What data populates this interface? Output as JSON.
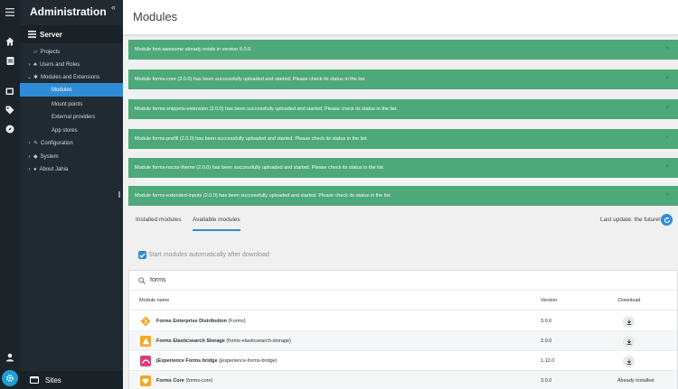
{
  "rail": {
    "icons": [
      "menu-icon",
      "home-icon",
      "clipboard-icon",
      "gallery-icon",
      "tag-icon",
      "compass-icon",
      "user-icon",
      "gear-icon"
    ]
  },
  "sidebar": {
    "title": "Administration",
    "collapse": "«",
    "server_label": "Server",
    "items": [
      {
        "label": "Projects",
        "prefix": "▱"
      },
      {
        "label": "Users and Roles",
        "arrow": "›",
        "prefix": "♣"
      },
      {
        "label": "Modules and Extensions",
        "arrow": "⌄",
        "prefix": "✱"
      },
      {
        "label": "Modules",
        "active": true
      },
      {
        "label": "Mount points"
      },
      {
        "label": "External providers"
      },
      {
        "label": "App stores"
      },
      {
        "label": "Configuration",
        "arrow": "›",
        "prefix": "✎"
      },
      {
        "label": "System",
        "arrow": "›",
        "prefix": "◆"
      },
      {
        "label": "About Jahia",
        "arrow": "›",
        "prefix": "●"
      }
    ],
    "sites_label": "Sites"
  },
  "header": {
    "title": "Modules"
  },
  "notifications": [
    "Module font-awesome already exists in version 6.0.0.",
    "Module forms-core (3.0.0) has been successfully uploaded and started. Please check its status in the list.",
    "Module forms-snippets-extension (3.0.0) has been successfully uploaded and started. Please check its status in the list.",
    "Module forms-prefill (2.0.0) has been successfully uploaded and started. Please check its status in the list.",
    "Module forms-nocss-theme (2.0.0) has been successfully uploaded and started. Please check its status in the list.",
    "Module forms-extended-inputs (2.0.0) has been successfully uploaded and started. Please check its status in the list."
  ],
  "notification_close": "×",
  "tabs": [
    {
      "label": "Installed modules",
      "active": false
    },
    {
      "label": "Available modules",
      "active": true
    }
  ],
  "last_update": "Last update: the future!",
  "auto_start": {
    "label": "Start modules automatically after download",
    "checked": true
  },
  "search": {
    "value": "forms"
  },
  "table": {
    "headers": {
      "name": "Module name",
      "version": "Version",
      "download": "Download"
    },
    "rows": [
      {
        "title": "Forms Enterprise Distribution",
        "id": "(Forms)",
        "version": "3.0.0",
        "color": "#f5a623",
        "icon": "diamond-icon",
        "installed": ""
      },
      {
        "title": "Forms Elasticsearch Storage",
        "id": "(forms-elasticsearch-storage)",
        "version": "2.0.0",
        "color": "#f5a623",
        "icon": "warning-triangle-icon",
        "installed": ""
      },
      {
        "title": "jExperience Forms bridge",
        "id": "(jexperience-forms-bridge)",
        "version": "1.12.0",
        "color": "#d6417c",
        "icon": "bridge-icon",
        "installed": ""
      },
      {
        "title": "Forms Core",
        "id": "(forms-core)",
        "version": "3.0.0",
        "color": "#f5a623",
        "icon": "heart-icon",
        "installed": "Already installed"
      }
    ]
  },
  "colors": {
    "accent": "#2e8cd8",
    "notification": "#4da87a",
    "sidebar": "#222a31",
    "rail": "#1c2329"
  }
}
